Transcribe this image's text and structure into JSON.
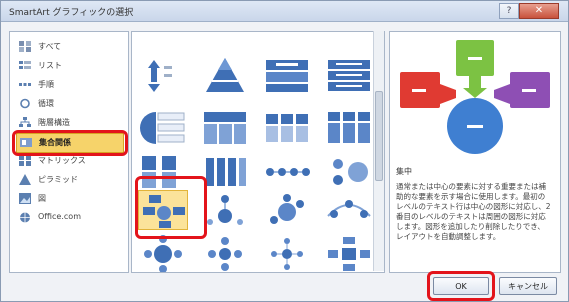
{
  "window": {
    "title": "SmartArt グラフィックの選択",
    "help_label": "?",
    "close_label": "✕"
  },
  "categories": [
    {
      "label": "すべて",
      "icon": "all-icon"
    },
    {
      "label": "リスト",
      "icon": "list-icon"
    },
    {
      "label": "手順",
      "icon": "process-icon"
    },
    {
      "label": "循環",
      "icon": "cycle-icon"
    },
    {
      "label": "階層構造",
      "icon": "hierarchy-icon"
    },
    {
      "label": "集合関係",
      "icon": "relationship-icon",
      "selected": true
    },
    {
      "label": "マトリックス",
      "icon": "matrix-icon"
    },
    {
      "label": "ピラミッド",
      "icon": "pyramid-icon"
    },
    {
      "label": "図",
      "icon": "picture-icon"
    },
    {
      "label": "Office.com",
      "icon": "office-com-icon"
    }
  ],
  "detail": {
    "name": "集中",
    "description": "通常または中心の要素に対する重要または補助的な要素を示す場合に使用します。最初のレベルのテキスト行は中心の図形に対応し、2 番目のレベルのテキストは周囲の図形に対応します。図形を追加したり削除したりでき、レイアウトを自動調整します。"
  },
  "buttons": {
    "ok": "OK",
    "cancel": "キャンセル"
  },
  "colors": {
    "selection": "#f6d36a",
    "highlight_red": "#e3141b",
    "preview_red": "#e03a32",
    "preview_green": "#7cc243",
    "preview_purple": "#8e4fb4",
    "preview_blue": "#3f7fd1"
  }
}
